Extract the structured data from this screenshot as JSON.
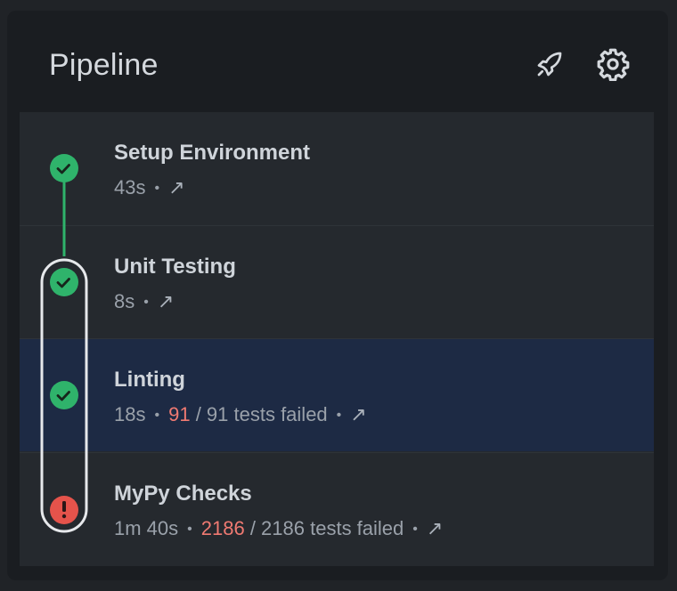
{
  "header": {
    "title": "Pipeline",
    "icons": [
      "rocket-icon",
      "gear-icon"
    ]
  },
  "steps": [
    {
      "name": "Setup Environment",
      "duration": "43s",
      "status": "success",
      "link": "↗"
    },
    {
      "name": "Unit Testing",
      "duration": "8s",
      "status": "success",
      "link": "↗"
    },
    {
      "name": "Linting",
      "duration": "18s",
      "status": "success",
      "failed": "91",
      "total_text": " / 91 tests failed",
      "link": "↗",
      "selected": true
    },
    {
      "name": "MyPy Checks",
      "duration": "1m 40s",
      "status": "error",
      "failed": "2186",
      "total_text": " / 2186 tests failed",
      "link": "↗"
    }
  ],
  "separator": "•",
  "colors": {
    "success": "#2fb36b",
    "error": "#e5534b",
    "selected_row": "#1d2a44",
    "failed_count": "#f07a72"
  }
}
